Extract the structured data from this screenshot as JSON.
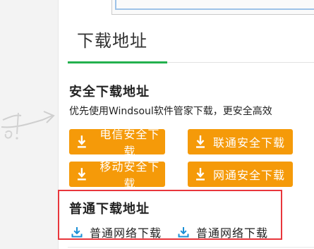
{
  "tab": {
    "title": "下载地址"
  },
  "safe_section": {
    "title": "安全下载地址",
    "description": "优先使用Windsoul软件管家下载，更安全高效",
    "buttons": [
      {
        "label": "电信安全下载",
        "icon": "download-icon"
      },
      {
        "label": "联通安全下载",
        "icon": "download-icon"
      },
      {
        "label": "移动安全下载",
        "icon": "download-icon"
      },
      {
        "label": "网通安全下载",
        "icon": "download-icon"
      }
    ]
  },
  "normal_section": {
    "title": "普通下载地址",
    "links": [
      {
        "label": "普通网络下载",
        "icon": "download-icon"
      },
      {
        "label": "普通网络下载",
        "icon": "download-icon"
      }
    ]
  },
  "colors": {
    "accent_green": "#23b14d",
    "button_orange": "#f59a09",
    "highlight_red": "#e8363c",
    "link_icon_blue": "#1a8fd6"
  }
}
